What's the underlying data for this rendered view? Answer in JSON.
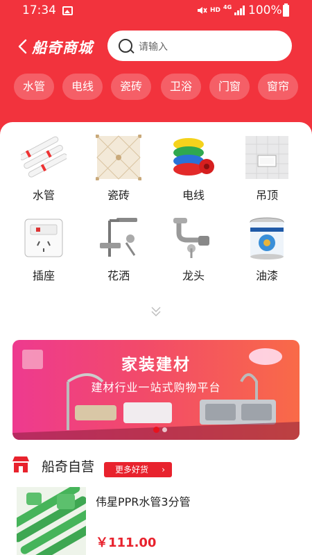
{
  "status_bar": {
    "time": "17:34",
    "network_hd": "HD",
    "network_type": "4G",
    "battery": "100%"
  },
  "header": {
    "shop_name": "船奇商城",
    "search_placeholder": "请输入"
  },
  "chips": [
    "水管",
    "电线",
    "瓷砖",
    "卫浴",
    "门窗",
    "窗帘"
  ],
  "categories": [
    {
      "label": "水管",
      "icon": "pipe-icon"
    },
    {
      "label": "瓷砖",
      "icon": "tile-icon"
    },
    {
      "label": "电线",
      "icon": "wire-icon"
    },
    {
      "label": "吊顶",
      "icon": "ceiling-icon"
    },
    {
      "label": "插座",
      "icon": "socket-icon"
    },
    {
      "label": "花洒",
      "icon": "shower-icon"
    },
    {
      "label": "龙头",
      "icon": "faucet-icon"
    },
    {
      "label": "油漆",
      "icon": "paint-icon"
    }
  ],
  "banner": {
    "title": "家装建材",
    "subtitle": "建材行业一站式购物平台"
  },
  "store": {
    "name": "船奇自营",
    "more_label": "更多好货"
  },
  "product": {
    "name": "伟星PPR水管3分管",
    "price": "￥111.00"
  },
  "colors": {
    "brand_red": "#f2333d",
    "price_red": "#e8222d"
  }
}
